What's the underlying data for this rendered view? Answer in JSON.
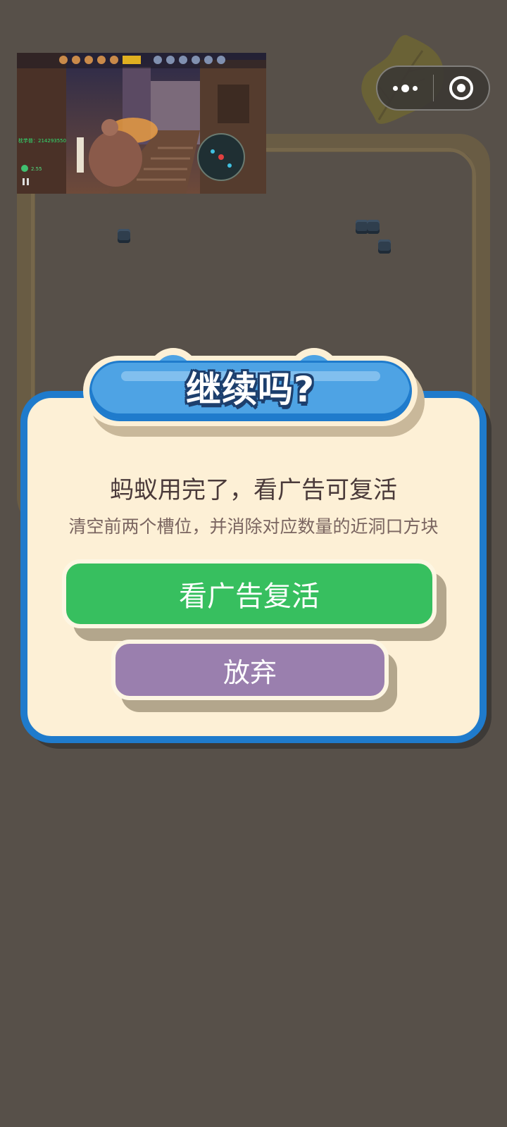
{
  "capsule": {
    "menu_icon": "more-dots-icon",
    "close_icon": "target-close-icon"
  },
  "ad_video": {
    "score_text": "枕芋普：214293550",
    "counter_text": "2.55"
  },
  "dialog": {
    "title": "继续吗?",
    "message": "蚂蚁用完了，看广告可复活",
    "detail": "清空前两个槽位，并消除对应数量的近洞口方块",
    "revive_button": "看广告复活",
    "give_up_button": "放弃"
  },
  "colors": {
    "background": "#575049",
    "dialog_fill": "#fdf0d6",
    "dialog_border": "#1f7bcc",
    "title_bar": "#4ea3e4",
    "revive_green": "#37bf5f",
    "give_up_purple": "#9a7fae"
  }
}
